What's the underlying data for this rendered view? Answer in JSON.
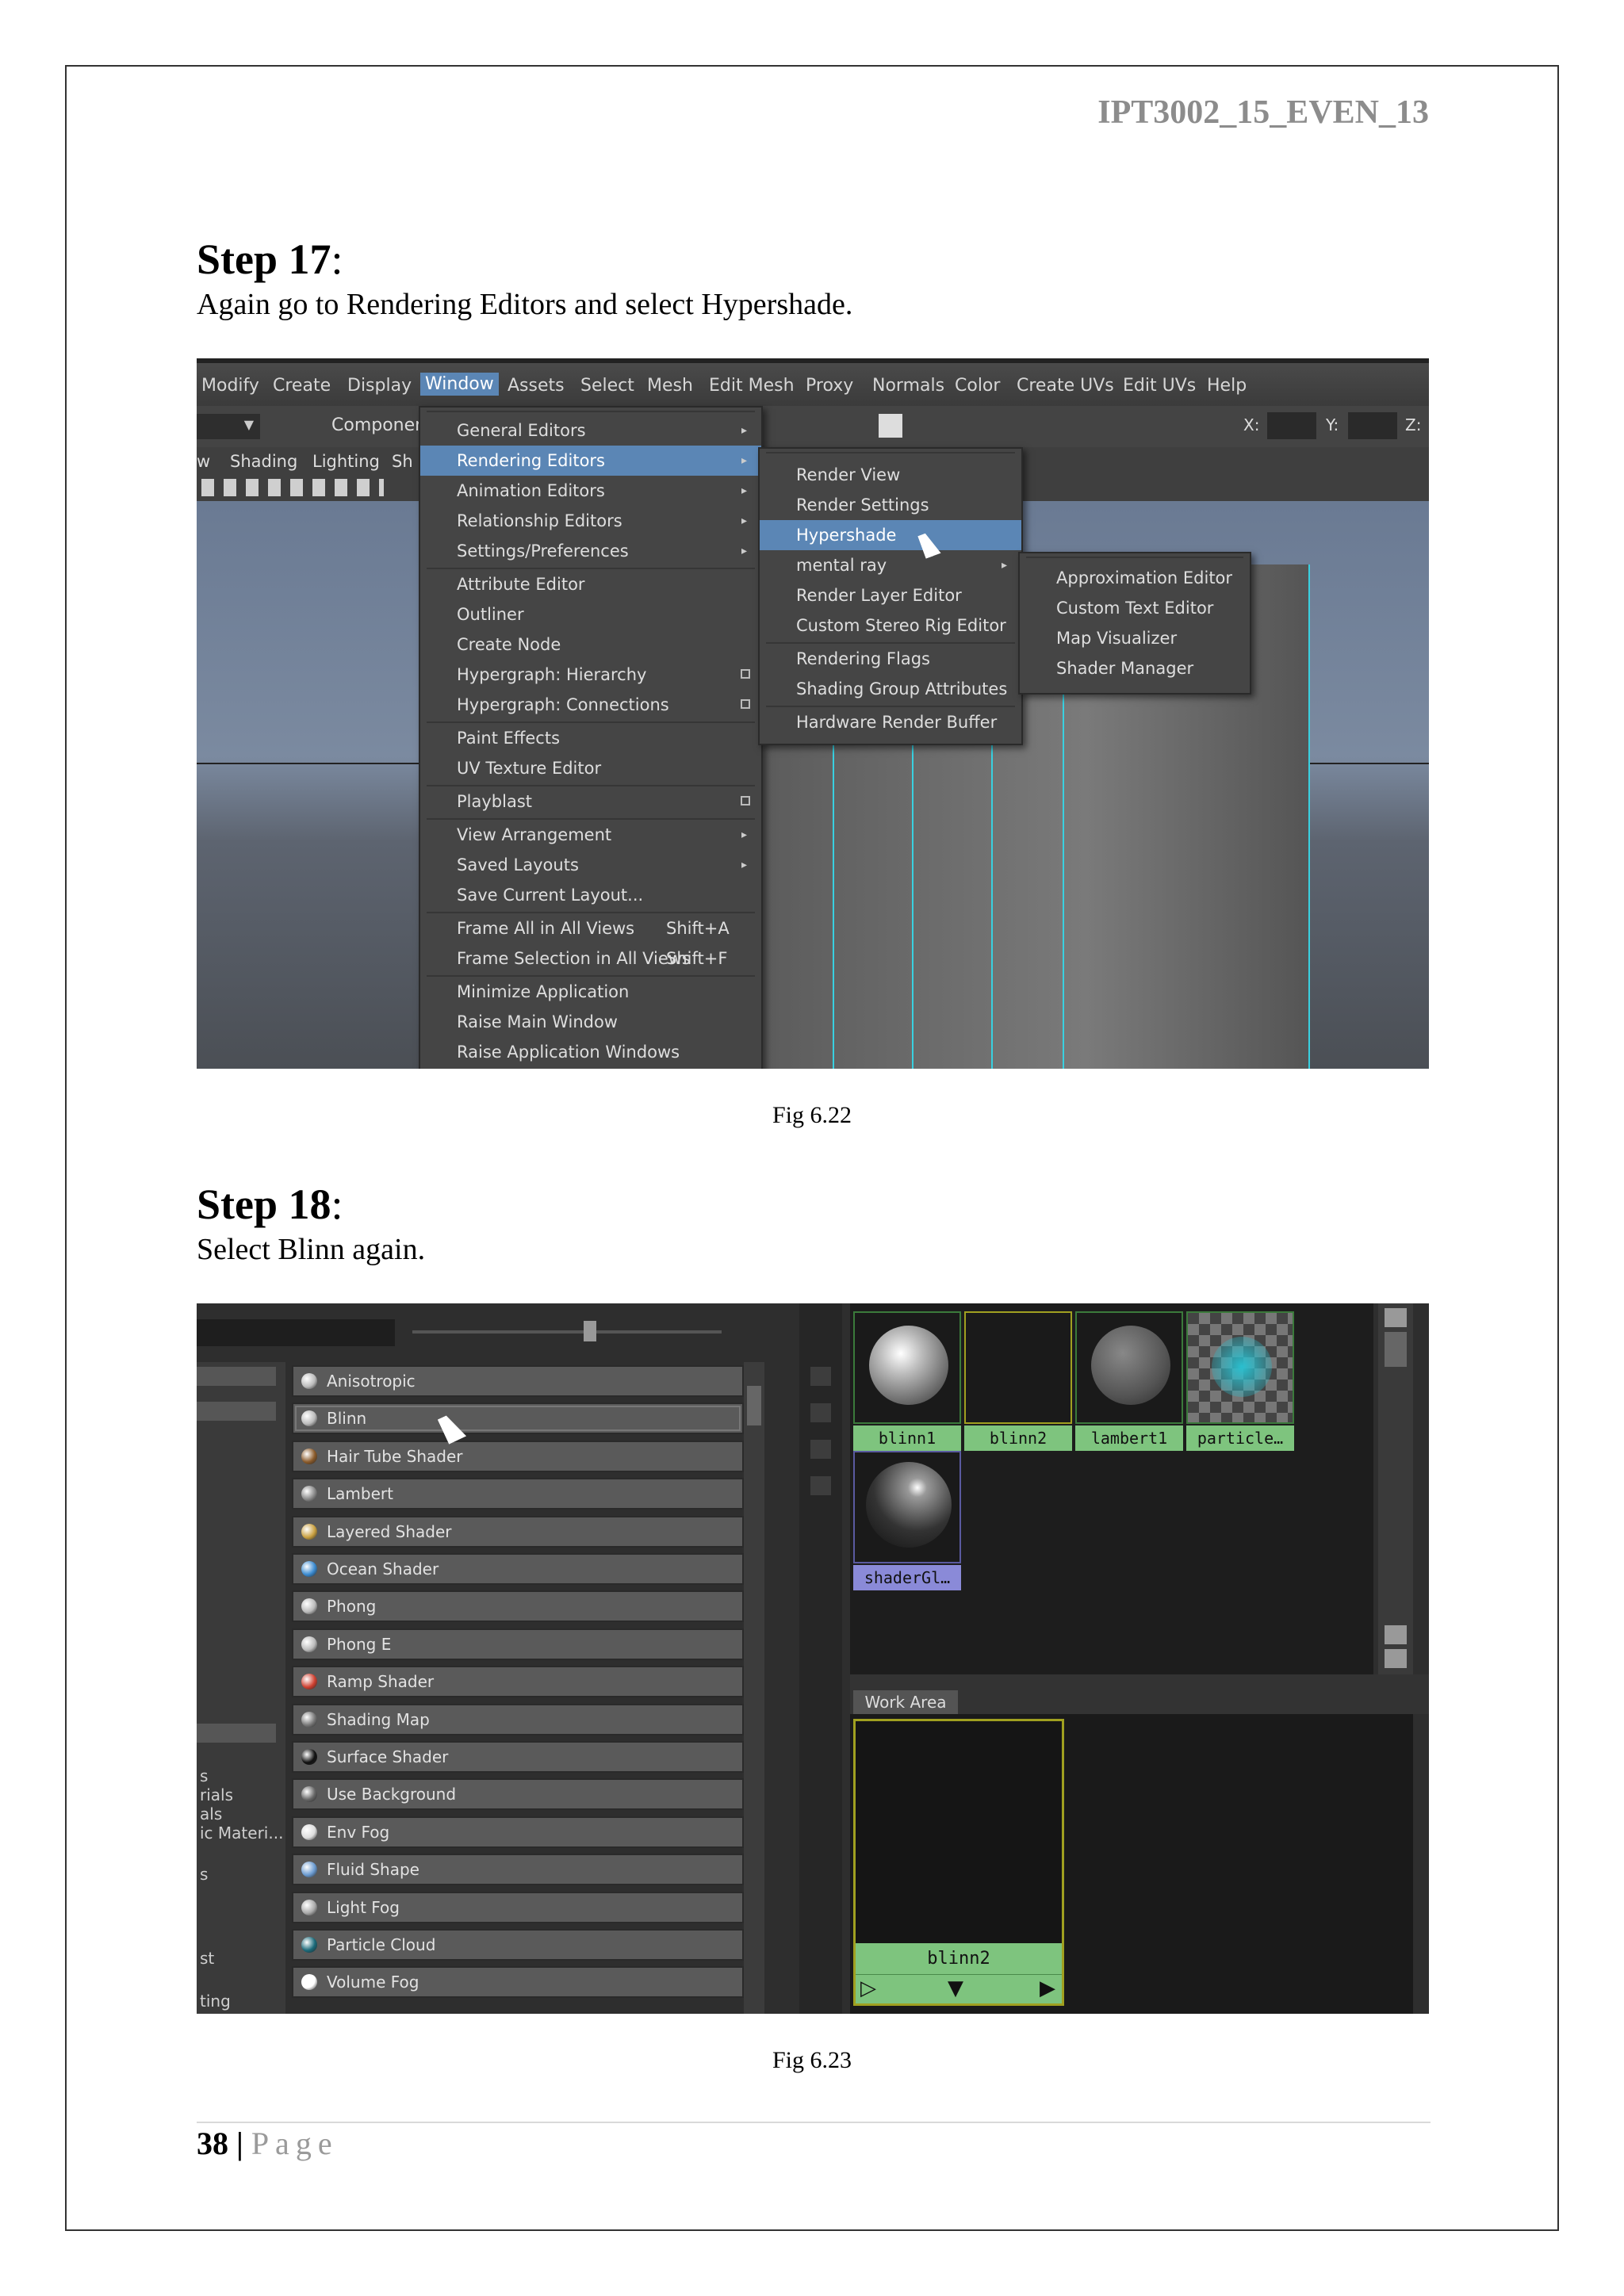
{
  "header": {
    "code": "IPT3002_15_EVEN_13"
  },
  "step17": {
    "title": "Step 17",
    "colon": ":",
    "text": "Again go to Rendering Editors and select Hypershade.",
    "caption": "Fig 6.22"
  },
  "step18": {
    "title": "Step 18",
    "colon": ":",
    "text": "Select Blinn again.",
    "caption": "Fig 6.23"
  },
  "footer": {
    "page_number": "38",
    "separator": "|",
    "page_label": "Page"
  },
  "fig1": {
    "menubar": [
      "Modify",
      "Create",
      "Display",
      "Window",
      "Assets",
      "Select",
      "Mesh",
      "Edit Mesh",
      "Proxy",
      "Normals",
      "Color",
      "Create UVs",
      "Edit UVs",
      "Help"
    ],
    "toolbar": {
      "component_label": "Component",
      "x_label": "X:",
      "y_label": "Y:",
      "z_label": "Z:"
    },
    "panel_menu": [
      "w",
      "Shading",
      "Lighting",
      "Sh"
    ],
    "window_menu": [
      {
        "label": "General Editors",
        "arrow": "▸"
      },
      {
        "label": "Rendering Editors",
        "arrow": "▸"
      },
      {
        "label": "Animation Editors",
        "arrow": "▸"
      },
      {
        "label": "Relationship Editors",
        "arrow": "▸"
      },
      {
        "label": "Settings/Preferences",
        "arrow": "▸"
      },
      {
        "label": "Attribute Editor"
      },
      {
        "label": "Outliner"
      },
      {
        "label": "Create Node"
      },
      {
        "label": "Hypergraph: Hierarchy"
      },
      {
        "label": "Hypergraph: Connections"
      },
      {
        "label": "Paint Effects"
      },
      {
        "label": "UV Texture Editor"
      },
      {
        "label": "Playblast"
      },
      {
        "label": "View Arrangement",
        "arrow": "▸"
      },
      {
        "label": "Saved Layouts",
        "arrow": "▸"
      },
      {
        "label": "Save Current Layout..."
      },
      {
        "label": "Frame All in All Views",
        "shortcut": "Shift+A"
      },
      {
        "label": "Frame Selection in All Views",
        "shortcut": "Shift+F"
      },
      {
        "label": "Minimize Application"
      },
      {
        "label": "Raise Main Window"
      },
      {
        "label": "Raise Application Windows"
      }
    ],
    "rendering_menu": [
      {
        "label": "Render View"
      },
      {
        "label": "Render Settings"
      },
      {
        "label": "Hypershade"
      },
      {
        "label": "mental ray",
        "arrow": "▸"
      },
      {
        "label": "Render Layer Editor"
      },
      {
        "label": "Custom Stereo Rig Editor"
      },
      {
        "label": "Rendering Flags"
      },
      {
        "label": "Shading Group Attributes"
      },
      {
        "label": "Hardware Render Buffer"
      }
    ],
    "mentalray_menu": [
      {
        "label": "Approximation Editor"
      },
      {
        "label": "Custom Text Editor"
      },
      {
        "label": "Map Visualizer"
      },
      {
        "label": "Shader Manager"
      }
    ]
  },
  "fig2": {
    "left_labels": [
      "s",
      "rials",
      "als",
      "ic Materi...",
      "s",
      "st",
      "ting"
    ],
    "shader_list": [
      {
        "label": "Anisotropic",
        "color": "#bbbbbb"
      },
      {
        "label": "Blinn",
        "color": "#bbbbbb"
      },
      {
        "label": "Hair Tube Shader",
        "color": "#8a5a2a"
      },
      {
        "label": "Lambert",
        "color": "#888888"
      },
      {
        "label": "Layered Shader",
        "color": "#c9a040"
      },
      {
        "label": "Ocean Shader",
        "color": "#3a8ad0"
      },
      {
        "label": "Phong",
        "color": "#bbbbbb"
      },
      {
        "label": "Phong E",
        "color": "#bbbbbb"
      },
      {
        "label": "Ramp Shader",
        "color": "#d04030"
      },
      {
        "label": "Shading Map",
        "color": "#777777"
      },
      {
        "label": "Surface Shader",
        "color": "#111111"
      },
      {
        "label": "Use Background",
        "color": "#666666"
      },
      {
        "label": "Env Fog",
        "color": "#dddddd"
      },
      {
        "label": "Fluid Shape",
        "color": "#6a9ad0"
      },
      {
        "label": "Light Fog",
        "color": "#aaaaaa"
      },
      {
        "label": "Particle Cloud",
        "color": "#1a6a7a"
      },
      {
        "label": "Volume Fog",
        "color": "#ffffff"
      }
    ],
    "swatches": [
      "blinn1",
      "blinn2",
      "lambert1",
      "particle…",
      "shaderGl…"
    ],
    "work_area_tab": "Work Area",
    "work_node": {
      "label": "blinn2",
      "controls": [
        "▷",
        "▼",
        "▶"
      ]
    }
  }
}
